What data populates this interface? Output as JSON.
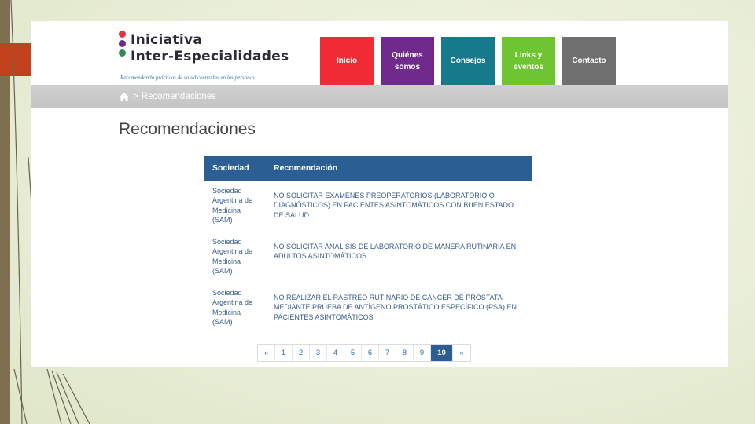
{
  "logo": {
    "line1": "Iniciativa",
    "line2": "Inter-Especialidades",
    "tagline": "Recomendando prácticas de salud centradas en las personas",
    "dot_colors": [
      "#e2343c",
      "#6a2b8c",
      "#2e8b57"
    ]
  },
  "nav": {
    "items": [
      {
        "label": "Inicio",
        "color": "#ef2b35"
      },
      {
        "label": "Quiénes somos",
        "color": "#6f2a8c"
      },
      {
        "label": "Consejos",
        "color": "#167a8b"
      },
      {
        "label": "Links y eventos",
        "color": "#6ec531"
      },
      {
        "label": "Contacto",
        "color": "#6f6f6f"
      }
    ],
    "active": "Consejos"
  },
  "breadcrumb": {
    "home_icon": "home-icon",
    "separator": ">",
    "current": "Recomendaciones"
  },
  "page_title": "Recomendaciones",
  "table": {
    "headers": [
      "Sociedad",
      "Recomendación"
    ],
    "rows": [
      {
        "sociedad": "Sociedad Argentina de Medicina (SAM)",
        "recomendacion": "NO SOLICITAR EXÁMENES PREOPERATORIOS (LABORATORIO O DIAGNÓSTICOS) EN PACIENTES ASINTOMÁTICOS CON BUEN ESTADO DE SALUD."
      },
      {
        "sociedad": "Sociedad Argentina de Medicina (SAM)",
        "recomendacion": "NO SOLICITAR ANÁLISIS DE LABORATORIO DE MANERA RUTINARIA EN ADULTOS ASINTOMÁTICOS."
      },
      {
        "sociedad": "Sociedad Argentina de Medicina (SAM)",
        "recomendacion": "NO REALIZAR EL RASTREO RUTINARIO DE CÁNCER DE PRÓSTATA MEDIANTE PRUEBA DE ANTÍGENO PROSTÁTICO ESPECÍFICO (PSA) EN PACIENTES ASINTOMÁTICOS"
      }
    ]
  },
  "pagination": {
    "prev": "«",
    "pages": [
      "1",
      "2",
      "3",
      "4",
      "5",
      "6",
      "7",
      "8",
      "9",
      "10"
    ],
    "current": "10",
    "next": "»"
  }
}
